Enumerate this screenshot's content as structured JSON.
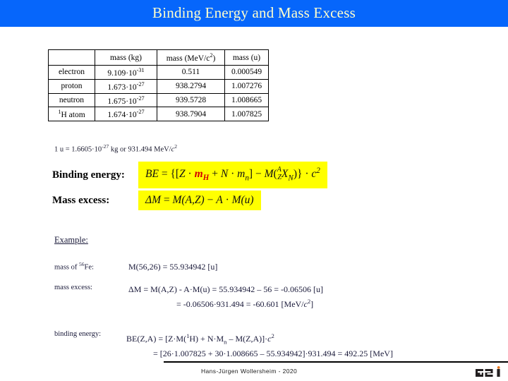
{
  "header": {
    "title": "Binding Energy and Mass Excess",
    "bg_color": "#0666fb",
    "text_color": "#ffffcc"
  },
  "table": {
    "columns": [
      "",
      "mass (kg)",
      "mass (MeV/c²)",
      "mass (u)"
    ],
    "col_header_kg": "mass (kg)",
    "col_header_mev_pre": "mass (MeV/c",
    "col_header_mev_sup": "2",
    "col_header_mev_post": ")",
    "col_header_u": "mass (u)",
    "rows": [
      {
        "label": "electron",
        "kg_mantissa": "9.109·10",
        "kg_exponent": "-31",
        "mev": "0.511",
        "u": "0.000549"
      },
      {
        "label": "proton",
        "kg_mantissa": "1.673·10",
        "kg_exponent": "-27",
        "mev": "938.2794",
        "u": "1.007276"
      },
      {
        "label": "neutron",
        "kg_mantissa": "1.675·10",
        "kg_exponent": "-27",
        "mev": "939.5728",
        "u": "1.008665"
      },
      {
        "label_sup": "1",
        "label": "H atom",
        "kg_mantissa": "1.674·10",
        "kg_exponent": "-27",
        "mev": "938.7904",
        "u": "1.007825"
      }
    ]
  },
  "unit_note": {
    "pre": "1 u = 1.6605·10",
    "exponent": "-27",
    "mid": " kg   or   931.494 MeV/",
    "italic_c": "c",
    "sup_c": "2"
  },
  "binding_energy": {
    "label": "Binding energy:",
    "formula_plain": "BE = {[Z · mH + N · mn] − M(AZ XN)} · c2",
    "be": "BE",
    "eq": " = ",
    "open": "{[",
    "z": "Z",
    "dot1": " · ",
    "mh_m": "m",
    "mh_sub": "H",
    "plus": " + ",
    "n": "N",
    "dot2": " · ",
    "mn_m": "m",
    "mn_sub": "n",
    "close_brack": "]",
    "minus": " − ",
    "mcap": "M",
    "paren_open": "(",
    "nuc_a": "A",
    "nuc_z": "Z",
    "nuc_x": "X",
    "nuc_n": "N",
    "paren_close": ")",
    "close_brace": "}",
    "dot3": " · ",
    "c": "c",
    "c_sup": "2",
    "highlight_color": "#ffff00",
    "red_color": "#d40000"
  },
  "mass_excess": {
    "label": "Mass excess:",
    "formula_plain": "ΔM = M(A,Z) − A · M(u)",
    "dm": "ΔM",
    "eq": " = ",
    "m1": "M(A,Z)",
    "minus": " − ",
    "a": "A",
    "dot": " · ",
    "m2": "M(u)",
    "highlight_color": "#ffff00"
  },
  "example": {
    "heading": "Example:",
    "mass": {
      "label_pre": "mass of ",
      "label_sup": "56",
      "label_post": "Fe:",
      "line1": "M(56,26) = 55.934942 [u]"
    },
    "excess": {
      "label": "mass excess:",
      "line1_pre": "ΔM = M(A,Z) - A·M(u) = 55.934942 – 56 = -0.06506 [u]",
      "line2_pre": "= -0.06506·931.494 = -60.601 [MeV/",
      "line2_c": "c",
      "line2_sup": "2",
      "line2_post": "]"
    },
    "binding": {
      "label": "binding energy:",
      "line1_pre": "BE(Z,A) = [Z·M(",
      "line1_sup1": "1",
      "line1_mid": "H) + N·M",
      "line1_sub": "n",
      "line1_mid2": " – M(Z,A)]·",
      "line1_c": "c",
      "line1_sup2": "2",
      "line2_pre": "= [26·1.007825 + 30·1.008665 – 55.934942]·931.494 = 492.25 [MeV]"
    }
  },
  "footer": {
    "credit": "Hans-Jürgen Wollersheim - 2020",
    "logo_text": "GSI",
    "logo_accent_color": "#e8761b"
  }
}
